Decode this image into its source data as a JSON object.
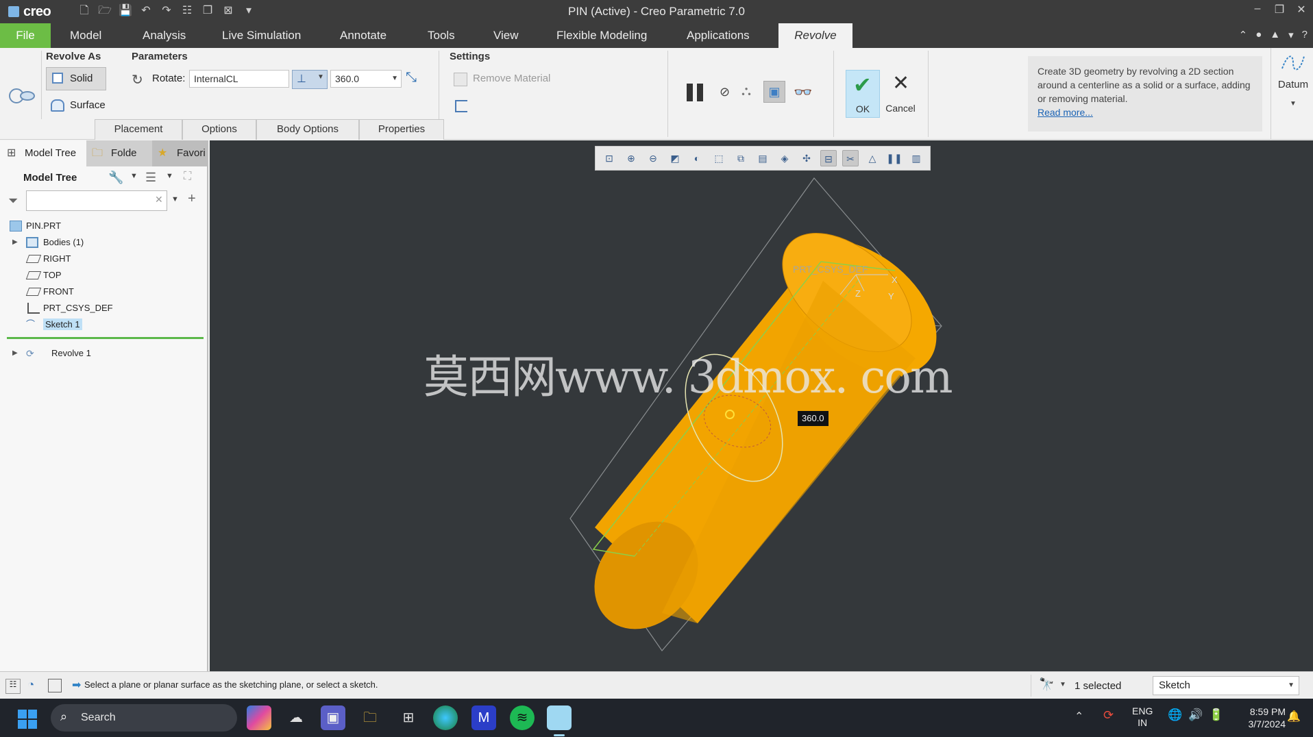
{
  "window": {
    "app_logo": "creo",
    "title": "PIN (Active) - Creo Parametric 7.0"
  },
  "menu": {
    "items": [
      "File",
      "Model",
      "Analysis",
      "Live Simulation",
      "Annotate",
      "Tools",
      "View",
      "Flexible Modeling",
      "Applications"
    ],
    "active_tab": "Revolve"
  },
  "ribbon": {
    "revolve_as": {
      "title": "Revolve As",
      "solid": "Solid",
      "surface": "Surface"
    },
    "parameters": {
      "title": "Parameters",
      "rotate_label": "Rotate:",
      "axis_value": "InternalCL",
      "angle_value": "360.0"
    },
    "settings": {
      "title": "Settings",
      "remove_material": "Remove Material"
    },
    "tabs": [
      "Placement",
      "Options",
      "Body Options",
      "Properties"
    ],
    "ok": "OK",
    "cancel": "Cancel",
    "tip_text": "Create 3D geometry by revolving a 2D section around a centerline as a solid or a surface, adding or removing material.",
    "tip_link": "Read more...",
    "datum": "Datum"
  },
  "left_panel": {
    "tabs": [
      "Model Tree",
      "Folde",
      "Favori"
    ],
    "header": "Model Tree",
    "search_placeholder": "",
    "tree": [
      {
        "label": "PIN.PRT",
        "icon": "part-icon",
        "expandable": false,
        "indent": 0
      },
      {
        "label": "Bodies (1)",
        "icon": "bodies-icon",
        "expandable": true,
        "indent": 1
      },
      {
        "label": "RIGHT",
        "icon": "datum-plane-icon",
        "expandable": false,
        "indent": 1
      },
      {
        "label": "TOP",
        "icon": "datum-plane-icon",
        "expandable": false,
        "indent": 1
      },
      {
        "label": "FRONT",
        "icon": "datum-plane-icon",
        "expandable": false,
        "indent": 1
      },
      {
        "label": "PRT_CSYS_DEF",
        "icon": "csys-icon",
        "expandable": false,
        "indent": 1
      },
      {
        "label": "Sketch 1",
        "icon": "sketch-icon",
        "expandable": false,
        "indent": 1,
        "selected": true
      }
    ],
    "insert_item": {
      "label": "Revolve 1",
      "icon": "revolve-icon"
    }
  },
  "viewport": {
    "csys_label": "PRT_CSYS_DEF",
    "axis_x": "X",
    "axis_y": "Y",
    "axis_z": "Z",
    "angle_tag": "360.0",
    "watermark": "莫西网www. 3dmox. com",
    "part_color": "#f5a300",
    "background": "#34383b"
  },
  "status": {
    "message": "Select a plane or planar surface as the sketching plane, or select a sketch.",
    "selected": "1 selected",
    "filter_value": "Sketch"
  },
  "taskbar": {
    "search": "Search",
    "lang_top": "ENG",
    "lang_bottom": "IN",
    "time": "8:59 PM",
    "date": "3/7/2024"
  }
}
